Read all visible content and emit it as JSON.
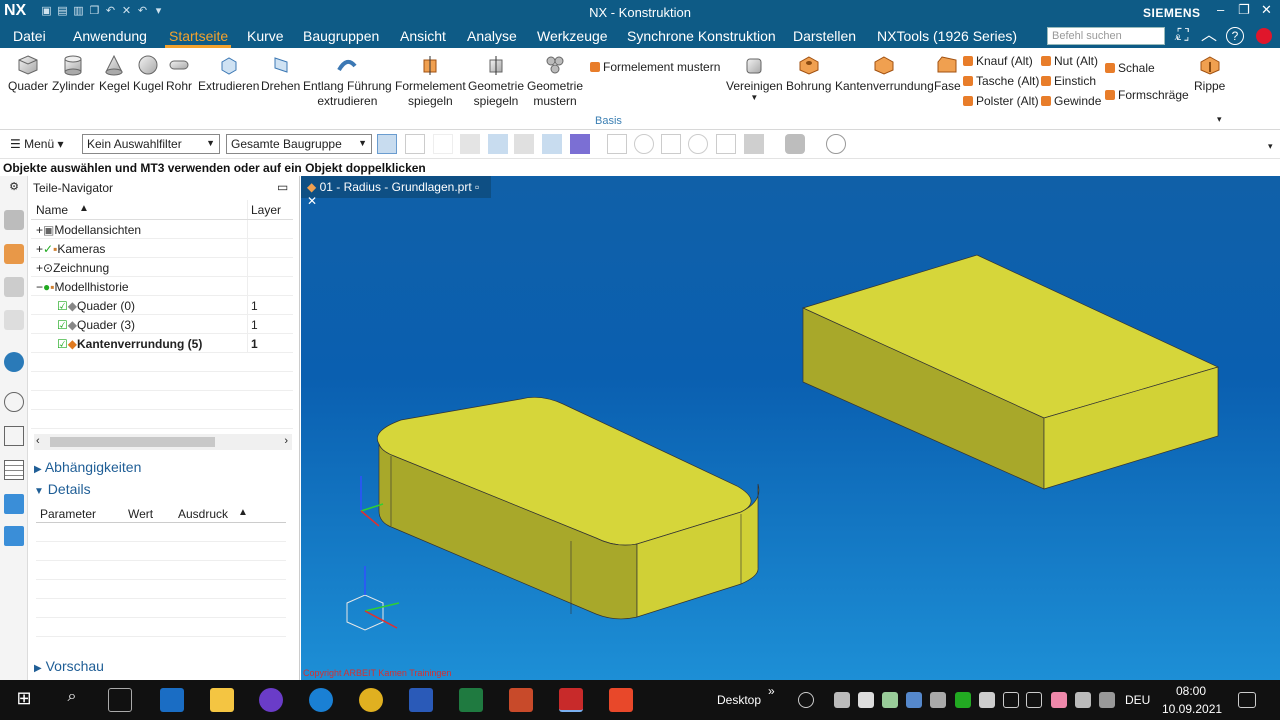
{
  "titlebar": {
    "logo": "NX",
    "title": "NX - Konstruktion",
    "brand": "SIEMENS"
  },
  "menubar": {
    "items": [
      "Datei",
      "Anwendung",
      "Startseite",
      "Kurve",
      "Baugruppen",
      "Ansicht",
      "Analyse",
      "Werkzeuge",
      "Synchrone Konstruktion",
      "Darstellen",
      "NXTools (1926 Series)"
    ],
    "search_placeholder": "Befehl suchen"
  },
  "ribbon": {
    "buttons": [
      "Quader",
      "Zylinder",
      "Kegel",
      "Kugel",
      "Rohr",
      "Extrudieren",
      "Drehen",
      "Entlang Führung\nextrudieren",
      "Formelement\nspiegeln",
      "Geometrie\nspiegeln",
      "Geometrie\nmustern"
    ],
    "formelement_mustern": "Formelement mustern",
    "right_buttons": [
      "Vereinigen",
      "Bohrung",
      "Kantenverrundung",
      "Fase",
      "Rippe"
    ],
    "small": [
      "Knauf (Alt)",
      "Tasche (Alt)",
      "Polster (Alt)",
      "Nut (Alt)",
      "Einstich",
      "Gewinde",
      "Schale",
      "Formschräge"
    ],
    "group_label": "Basis"
  },
  "toolbar": {
    "menu": "Menü",
    "filter": "Kein Auswahlfilter",
    "scope": "Gesamte Baugruppe"
  },
  "hint": "Objekte auswählen und MT3 verwenden oder auf ein Objekt doppelklicken",
  "navigator": {
    "title": "Teile-Navigator",
    "col_name": "Name",
    "col_layer": "Layer",
    "rows": [
      {
        "name": "Modellansichten",
        "layer": ""
      },
      {
        "name": "Kameras",
        "layer": ""
      },
      {
        "name": "Zeichnung",
        "layer": ""
      },
      {
        "name": "Modellhistorie",
        "layer": ""
      },
      {
        "name": "Quader (0)",
        "layer": "1"
      },
      {
        "name": "Quader (3)",
        "layer": "1"
      },
      {
        "name": "Kantenverrundung (5)",
        "layer": "1"
      }
    ],
    "sections": {
      "dependencies": "Abhängigkeiten",
      "details": "Details",
      "preview": "Vorschau"
    },
    "detail_cols": [
      "Parameter",
      "Wert",
      "Ausdruck"
    ]
  },
  "viewport": {
    "tab": "01 - Radius - Grundlagen.prt",
    "watermark": "Copyright ARBEIT Kamen Trainingen",
    "colors": {
      "part": "#d6d63a",
      "part_side": "#a8a82a"
    }
  },
  "taskbar": {
    "desktop": "Desktop",
    "lang": "DEU",
    "time": "08:00",
    "date": "10.09.2021"
  }
}
